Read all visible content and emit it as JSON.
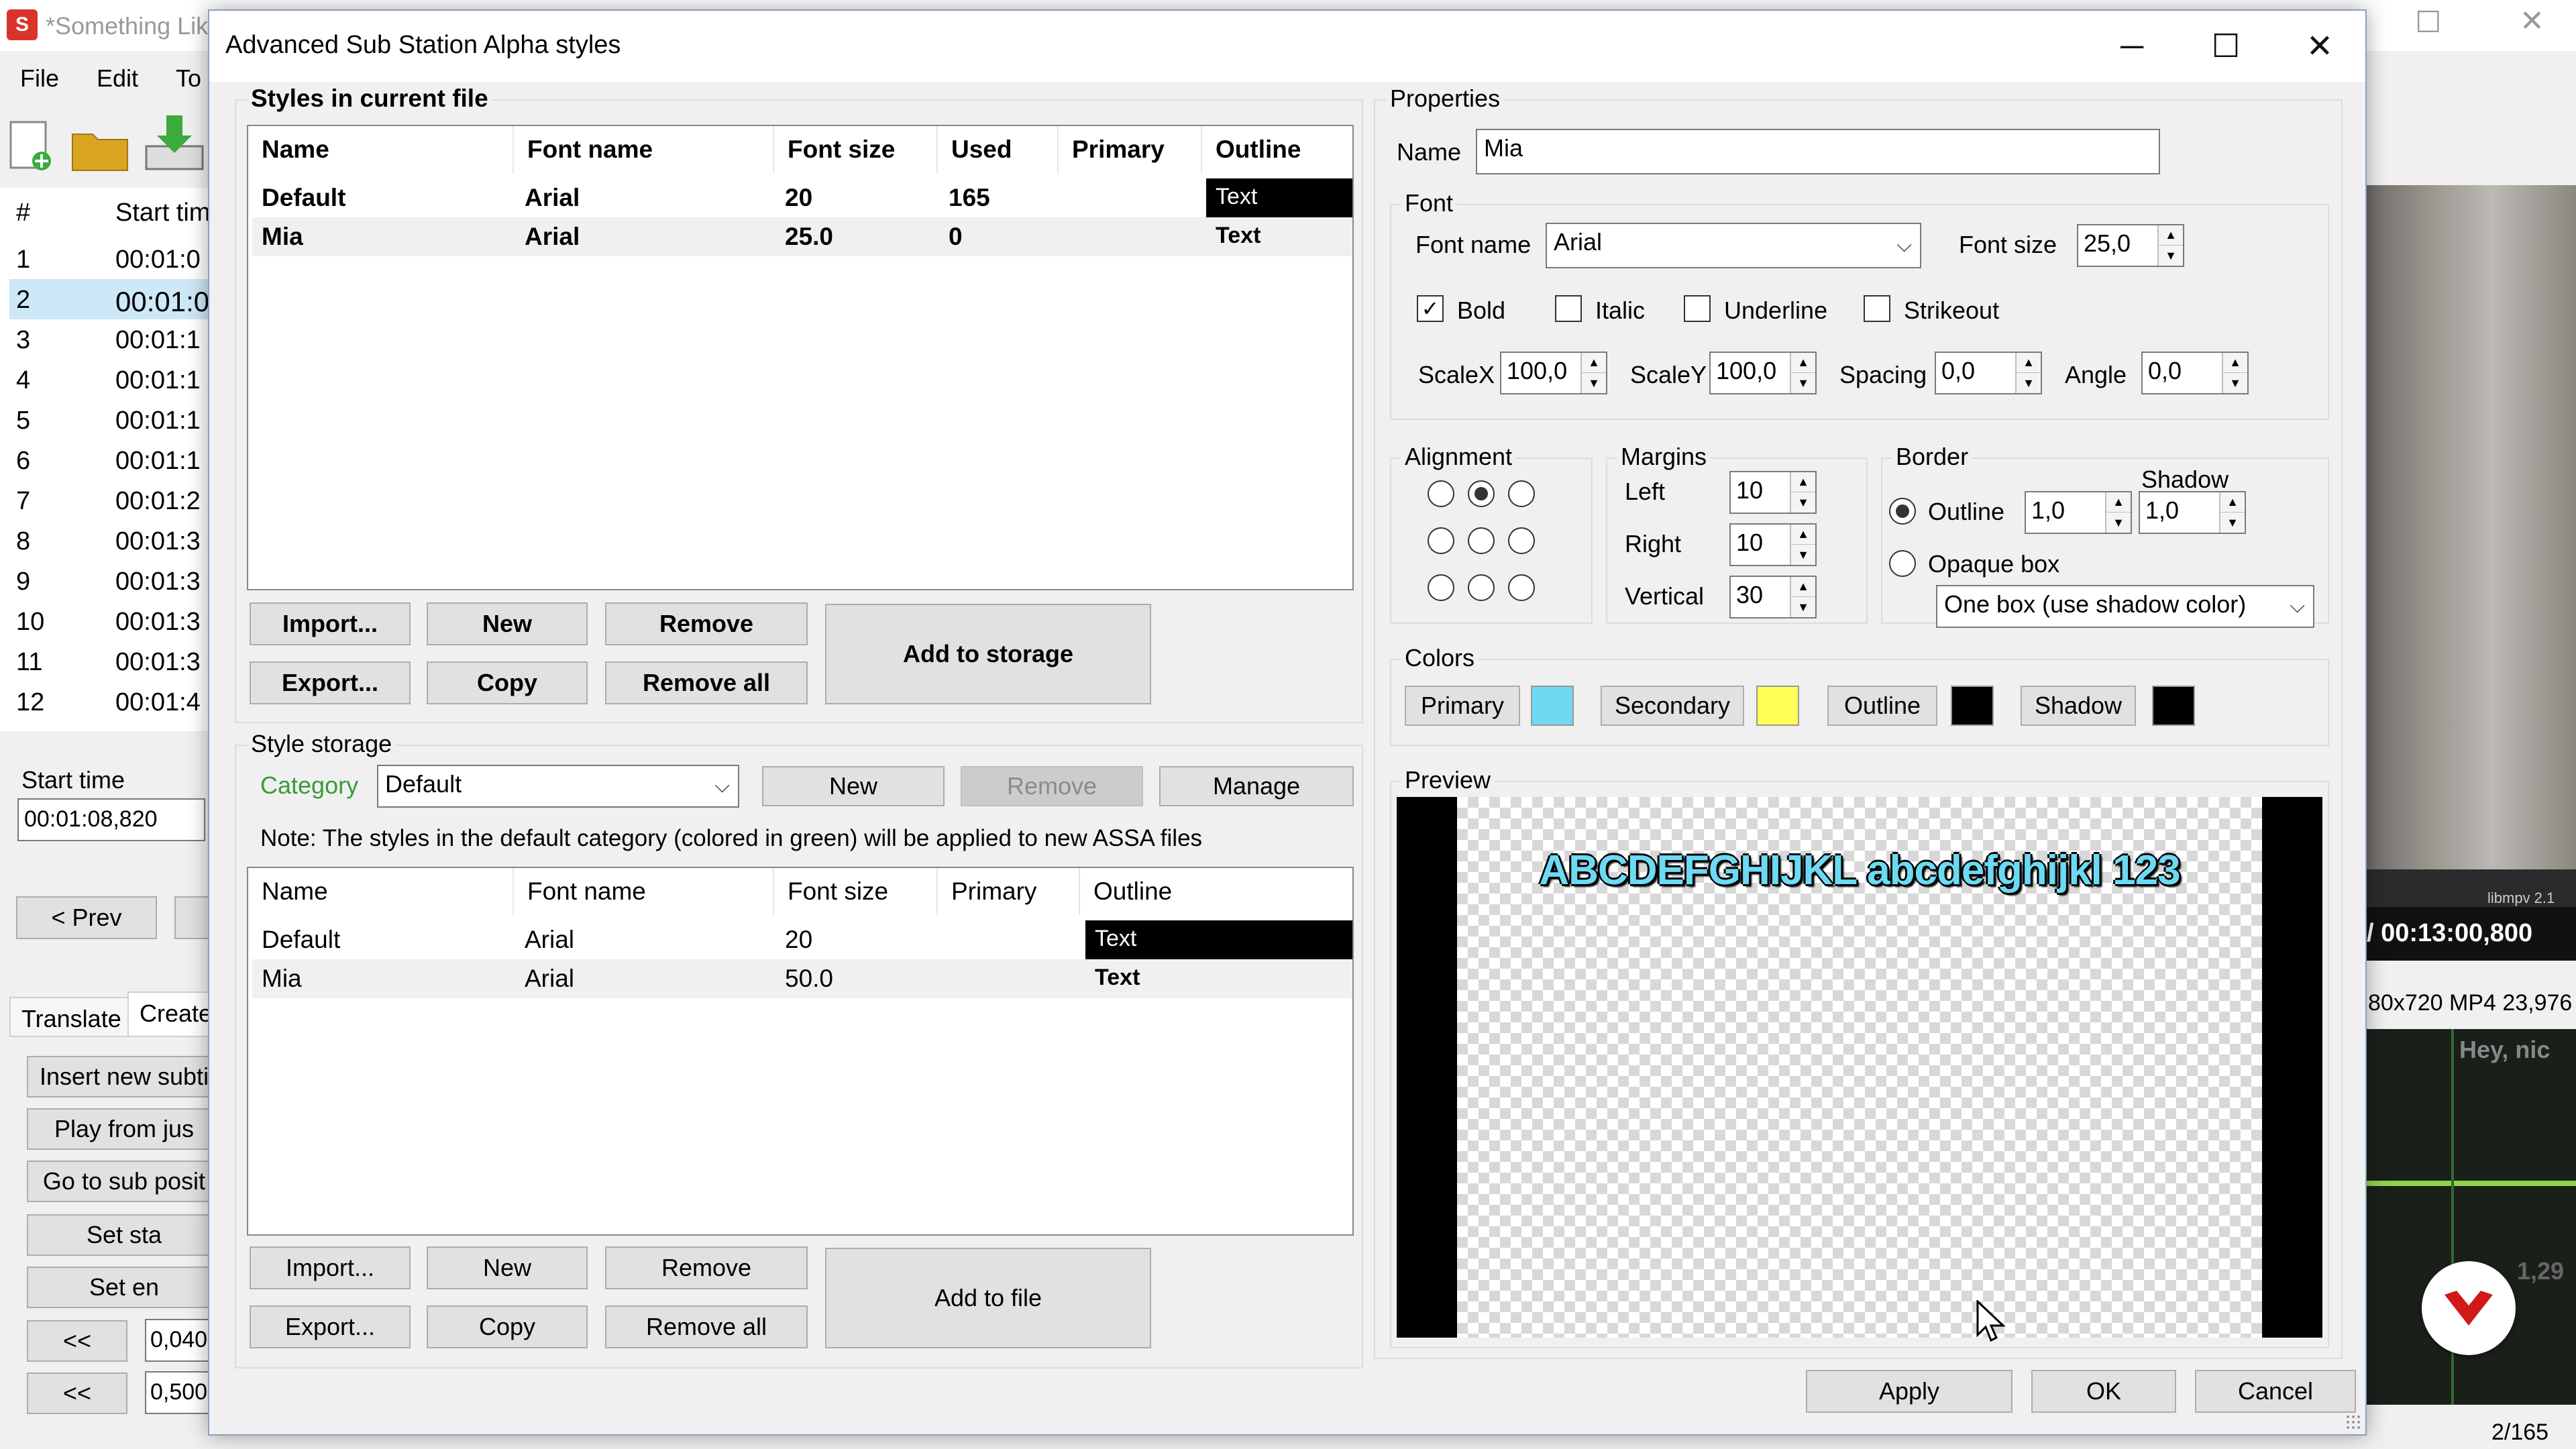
{
  "background_app": {
    "title": "*Something Lik",
    "menu": [
      "File",
      "Edit",
      "To"
    ],
    "grid_header": {
      "num": "#",
      "start": "Start tim"
    },
    "grid_rows": [
      {
        "num": "1",
        "time": "00:01:0"
      },
      {
        "num": "2",
        "time": "00:01:0"
      },
      {
        "num": "3",
        "time": "00:01:1"
      },
      {
        "num": "4",
        "time": "00:01:1"
      },
      {
        "num": "5",
        "time": "00:01:1"
      },
      {
        "num": "6",
        "time": "00:01:1"
      },
      {
        "num": "7",
        "time": "00:01:2"
      },
      {
        "num": "8",
        "time": "00:01:3"
      },
      {
        "num": "9",
        "time": "00:01:3"
      },
      {
        "num": "10",
        "time": "00:01:3"
      },
      {
        "num": "11",
        "time": "00:01:3"
      },
      {
        "num": "12",
        "time": "00:01:4"
      }
    ],
    "start_time_label": "Start time",
    "start_time_value": "00:01:08,820",
    "prev_button": "< Prev",
    "tabs": [
      "Translate",
      "Create"
    ],
    "side_buttons": [
      "Insert new subti",
      "Play from jus",
      "Go to sub posit",
      "Set sta",
      "Set en"
    ],
    "nudge_rows": [
      {
        "button": "<<",
        "value": "0,040"
      },
      {
        "button": "<<",
        "value": "0,500"
      }
    ],
    "video_time": "/ 00:13:00,800",
    "video_info": "80x720 MP4 23,976",
    "video_watermark": "libmpv 2.1",
    "waveform_text": "Hey, nic",
    "waveform_time": "1,29",
    "status": "2/165"
  },
  "dialog": {
    "title": "Advanced Sub Station Alpha styles",
    "controls": {
      "minimize": "─",
      "maximize": "☐",
      "close": "✕"
    },
    "styles_in_file": {
      "label": "Styles in current file",
      "columns": [
        "Name",
        "Font name",
        "Font size",
        "Used",
        "Primary",
        "Outline"
      ],
      "rows": [
        {
          "name": "Default",
          "font": "Arial",
          "size": "20",
          "used": "165",
          "outline": "Text"
        },
        {
          "name": "Mia",
          "font": "Arial",
          "size": "25.0",
          "used": "0",
          "outline": "Text"
        }
      ],
      "buttons": {
        "import": "Import...",
        "export": "Export...",
        "new": "New",
        "copy": "Copy",
        "remove": "Remove",
        "remove_all": "Remove all",
        "add_to_storage": "Add to storage"
      }
    },
    "storage": {
      "label": "Style storage",
      "category_label": "Category",
      "category_value": "Default",
      "new": "New",
      "remove": "Remove",
      "manage": "Manage",
      "note": "Note: The styles in the default category (colored in green) will be applied to new ASSA files",
      "columns": [
        "Name",
        "Font name",
        "Font size",
        "Primary",
        "Outline"
      ],
      "rows": [
        {
          "name": "Default",
          "font": "Arial",
          "size": "20",
          "outline": "Text"
        },
        {
          "name": "Mia",
          "font": "Arial",
          "size": "50.0",
          "outline": "Text"
        }
      ],
      "buttons": {
        "import": "Import...",
        "export": "Export...",
        "new": "New",
        "copy": "Copy",
        "remove": "Remove",
        "remove_all": "Remove all",
        "add_to_file": "Add to file"
      }
    },
    "properties": {
      "label": "Properties",
      "name_label": "Name",
      "name_value": "Mia",
      "font": {
        "label": "Font",
        "font_name_label": "Font name",
        "font_name_value": "Arial",
        "font_size_label": "Font size",
        "font_size_value": "25,0",
        "bold": "Bold",
        "italic": "Italic",
        "underline": "Underline",
        "strikeout": "Strikeout",
        "scalex_label": "ScaleX",
        "scalex_value": "100,0",
        "scaley_label": "ScaleY",
        "scaley_value": "100,0",
        "spacing_label": "Spacing",
        "spacing_value": "0,0",
        "angle_label": "Angle",
        "angle_value": "0,0"
      },
      "alignment_label": "Alignment",
      "margins": {
        "label": "Margins",
        "left_label": "Left",
        "left_value": "10",
        "right_label": "Right",
        "right_value": "10",
        "vertical_label": "Vertical",
        "vertical_value": "30"
      },
      "border": {
        "label": "Border",
        "outline_label": "Outline",
        "outline_value": "1,0",
        "shadow_label": "Shadow",
        "shadow_value": "1,0",
        "opaque_label": "Opaque box",
        "box_style_value": "One box (use shadow color)"
      },
      "colors": {
        "label": "Colors",
        "primary": "Primary",
        "secondary": "Secondary",
        "outline": "Outline",
        "shadow": "Shadow",
        "primary_color": "#6dd9f2",
        "secondary_color": "#ffff55",
        "outline_color": "#000000",
        "shadow_color": "#000000"
      },
      "preview_label": "Preview",
      "preview_text": "ABCDEFGHIJKL abcdefghijkl 123"
    },
    "footer": {
      "apply": "Apply",
      "ok": "OK",
      "cancel": "Cancel"
    }
  }
}
